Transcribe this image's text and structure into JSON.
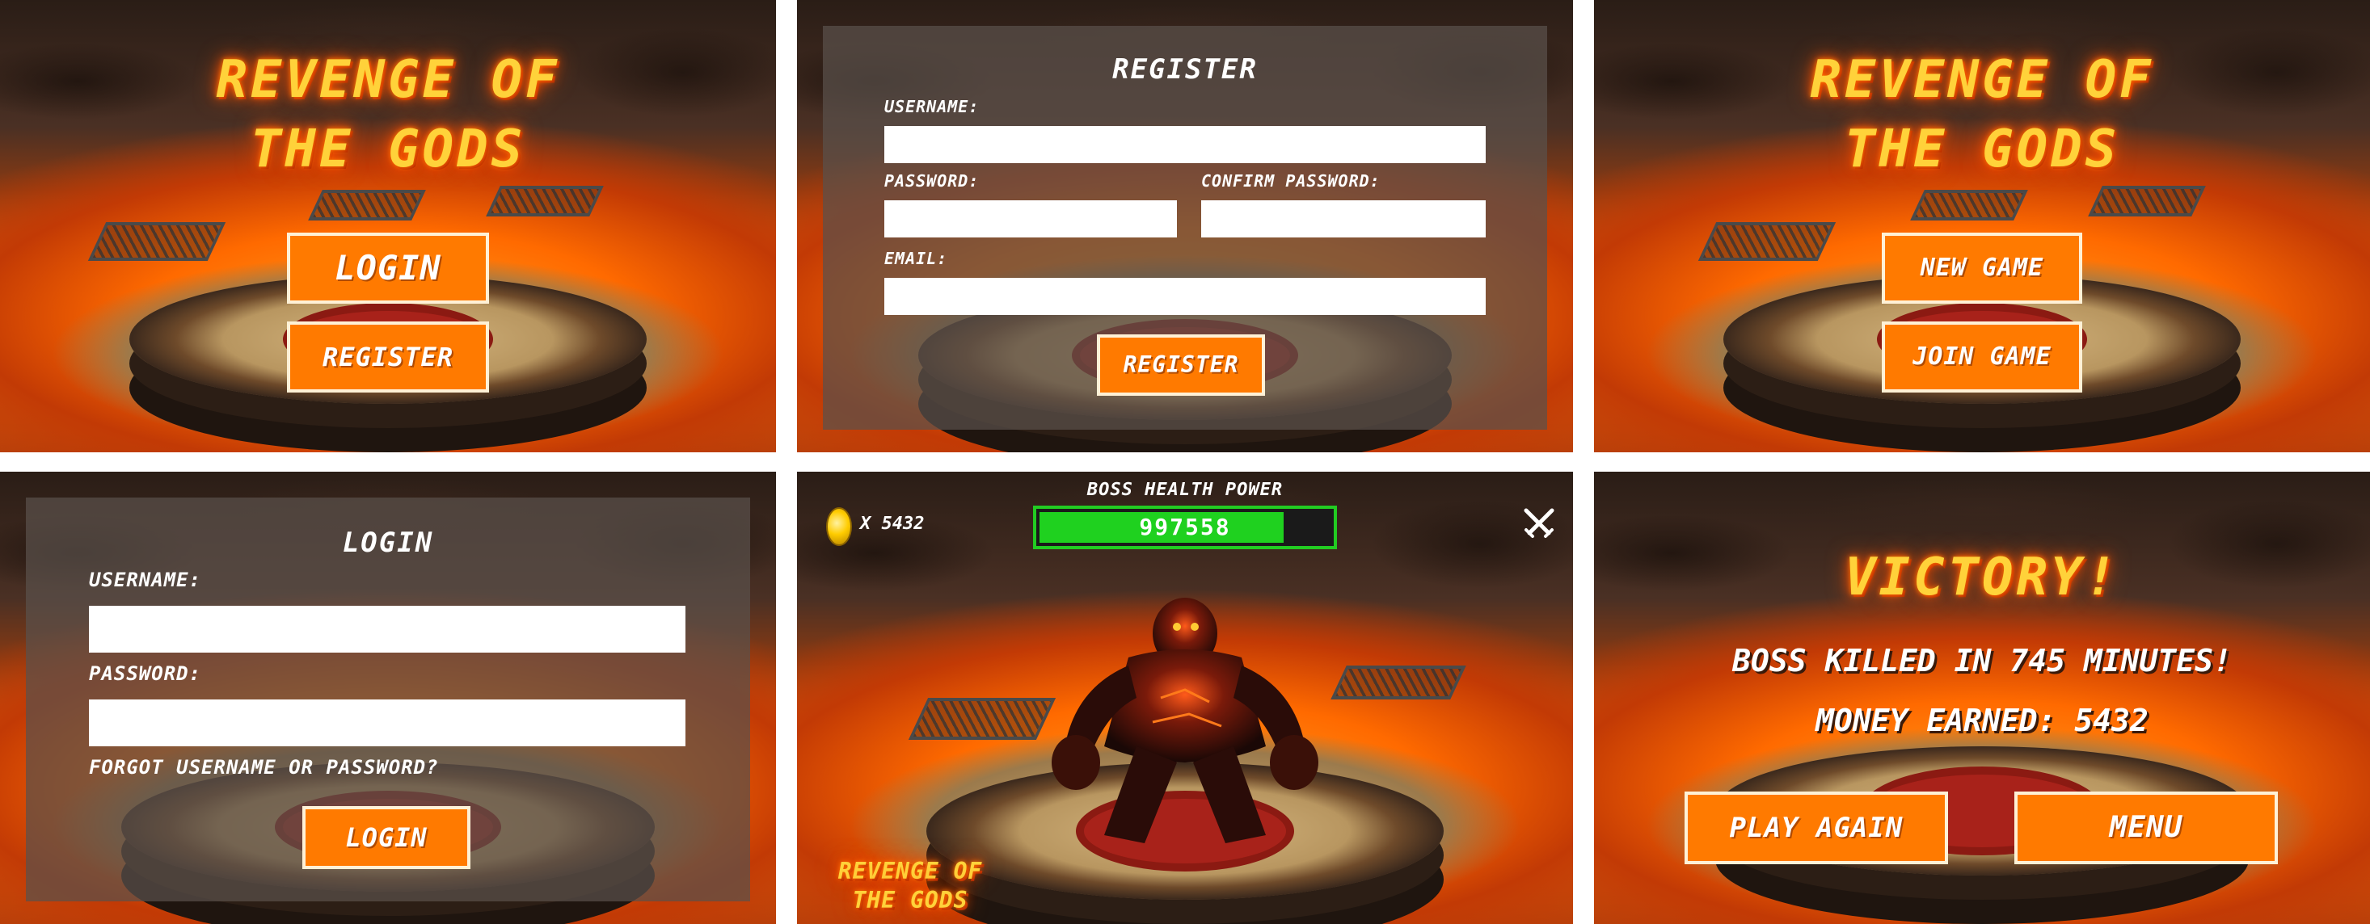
{
  "game_title": "REVENGE OF THE GODS",
  "title_lines": [
    "REVENGE OF",
    "THE GODS"
  ],
  "start_screen": {
    "login_button": "LOGIN",
    "register_button": "REGISTER"
  },
  "register_form": {
    "title": "REGISTER",
    "username_label": "USERNAME:",
    "password_label": "PASSWORD:",
    "confirm_password_label": "CONFIRM PASSWORD:",
    "email_label": "EMAIL:",
    "username_value": "",
    "password_value": "",
    "confirm_password_value": "",
    "email_value": "",
    "submit_button": "REGISTER"
  },
  "menu_screen": {
    "new_game_button": "NEW GAME",
    "join_game_button": "JOIN GAME"
  },
  "login_form": {
    "title": "LOGIN",
    "username_label": "USERNAME:",
    "password_label": "PASSWORD:",
    "username_value": "",
    "password_value": "",
    "forgot_link": "FORGOT USERNAME OR PASSWORD?",
    "submit_button": "LOGIN"
  },
  "hud": {
    "coin_count": "x 5432",
    "boss_health_label": "BOSS HEALTH POWER",
    "boss_health_value": "997558",
    "boss_health_fraction": 0.84,
    "close_icon": "crossed-swords-icon",
    "logo_lines": [
      "REVENGE OF",
      "THE GODS"
    ]
  },
  "victory_screen": {
    "title": "VICTORY!",
    "kill_message": "BOSS KILLED IN 745 MINUTES!",
    "money_message": "MONEY EARNED: 5432",
    "play_again_button": "PLAY AGAIN",
    "menu_button": "MENU"
  },
  "colors": {
    "button_orange": "#ff7a00",
    "title_yellow": "#ffd23a",
    "health_green": "#22cc22"
  }
}
